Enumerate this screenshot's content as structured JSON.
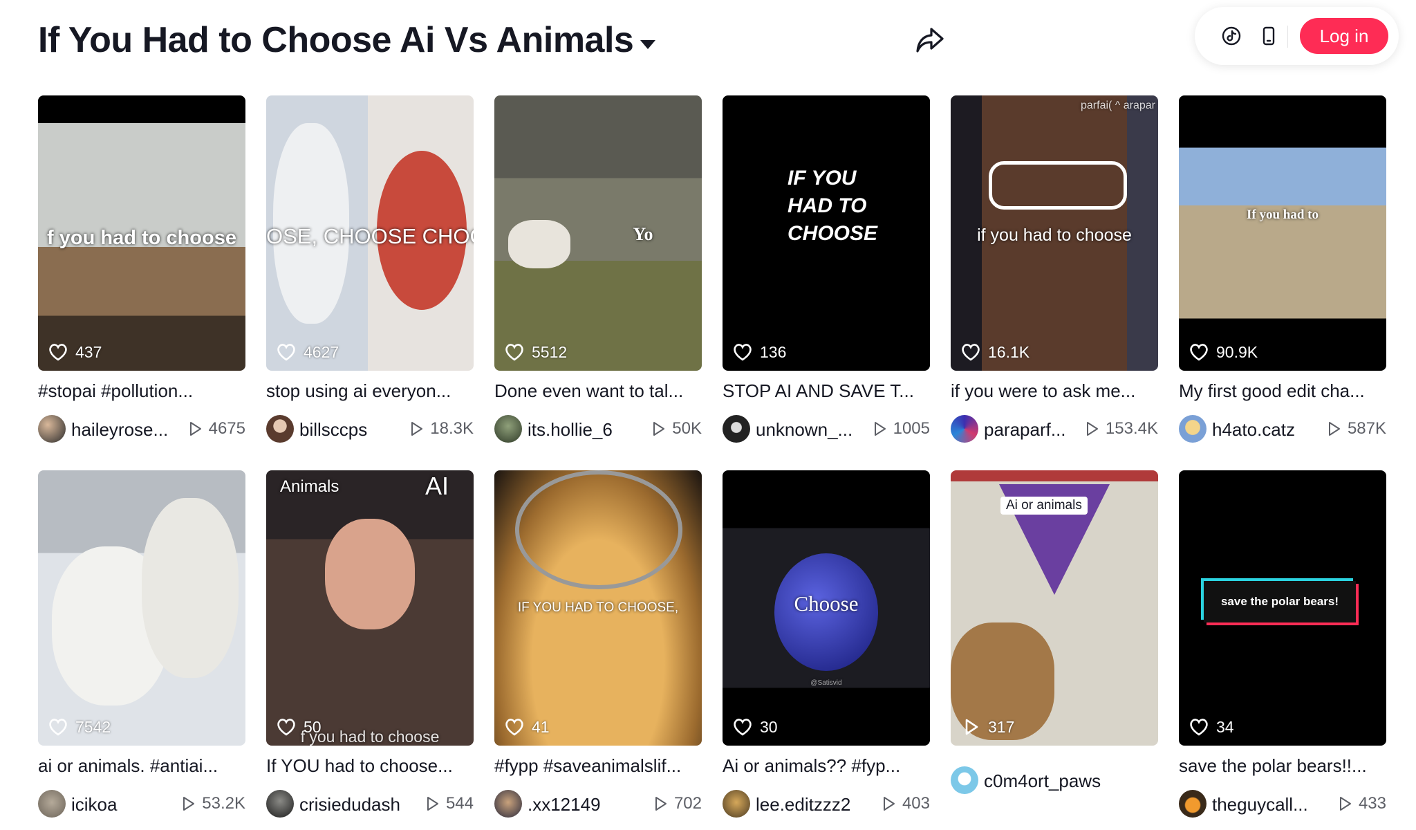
{
  "header": {
    "title": "If You Had to Choose Ai Vs Animals",
    "login_label": "Log in",
    "icons": [
      "tiktok-logo-icon",
      "mobile-device-icon",
      "share-arrow-icon",
      "chevron-down-icon"
    ]
  },
  "colors": {
    "accent": "#fe2c55",
    "text": "#161823",
    "muted": "#5d5f66"
  },
  "videos": [
    {
      "overlay": "f you had to choose",
      "likes": "437",
      "caption": "#stopai #pollution...",
      "user": "haileyrose...",
      "plays": "4675"
    },
    {
      "overlay": "OSE, CHOOSE CHOO",
      "likes": "4627",
      "caption": "stop using ai everyon...",
      "user": "billsccps",
      "plays": "18.3K"
    },
    {
      "overlay": "Yo",
      "likes": "5512",
      "caption": "Done even want to tal...",
      "user": "its.hollie_6",
      "plays": "50K"
    },
    {
      "overlay": "IF YOU HAD TO CHOOSE",
      "likes": "136",
      "caption": "STOP AI AND SAVE T...",
      "user": "unknown_...",
      "plays": "1005"
    },
    {
      "overlay": "if you had to choose",
      "overlay2": "parfai( ^ arapar",
      "likes": "16.1K",
      "caption": "if you were to ask me...",
      "user": "paraparf...",
      "plays": "153.4K"
    },
    {
      "overlay": "If you had to",
      "likes": "90.9K",
      "caption": "My first good edit cha...",
      "user": "h4ato.catz",
      "plays": "587K"
    },
    {
      "overlay": "",
      "likes": "7542",
      "caption": "ai or animals. #antiai...",
      "user": "icikoa",
      "plays": "53.2K"
    },
    {
      "overlay": "f you had to choose",
      "overlay_left": "Animals",
      "overlay_right": "AI",
      "likes": "50",
      "caption": "If YOU had to choose...",
      "user": "crisiedudash",
      "plays": "544"
    },
    {
      "overlay": "IF YOU HAD TO CHOOSE,",
      "likes": "41",
      "caption": "#fypp #saveanimalslif...",
      "user": ".xx12149",
      "plays": "702"
    },
    {
      "overlay": "Choose",
      "watermark": "@Satisvid",
      "likes": "30",
      "caption": "Ai or animals?? #fyp...",
      "user": "lee.editzzz2",
      "plays": "403"
    },
    {
      "overlay": "Ai or animals",
      "likes": "317",
      "caption": "",
      "user": "c0m4ort_paws",
      "plays": ""
    },
    {
      "overlay": "save the polar bears!",
      "likes": "34",
      "caption": "save the polar bears!!...",
      "user": "theguycall...",
      "plays": "433"
    }
  ]
}
